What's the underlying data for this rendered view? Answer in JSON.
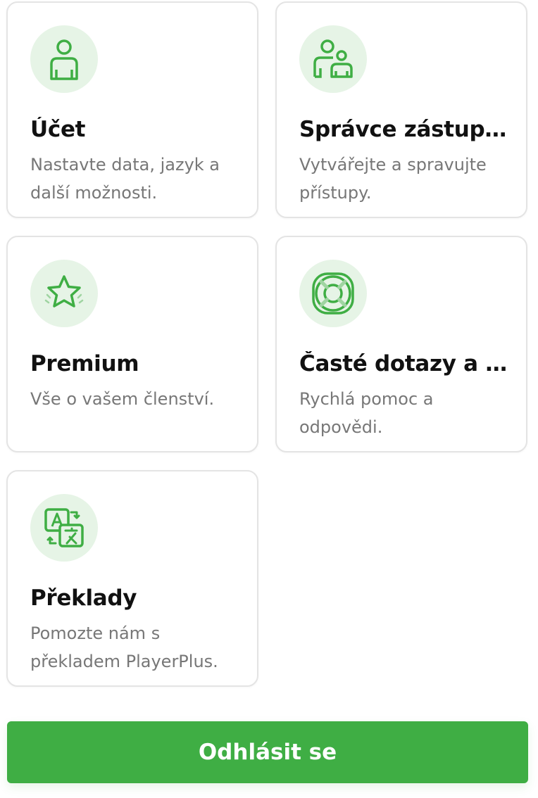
{
  "cards": [
    {
      "title": "Účet",
      "description": "Nastavte data, jazyk a další možnosti.",
      "icon": "user-icon"
    },
    {
      "title": "Správce zástupce",
      "description": "Vytvářejte a spravujte přístupy.",
      "icon": "users-icon"
    },
    {
      "title": "Premium",
      "description": "Vše o vašem členství.",
      "icon": "star-icon"
    },
    {
      "title": "Časté dotazy a po...",
      "description": "Rychlá pomoc a odpovědi.",
      "icon": "lifebuoy-icon"
    },
    {
      "title": "Překlady",
      "description": "Pomozte nám s překladem PlayerPlus.",
      "icon": "translate-icon"
    }
  ],
  "logout": {
    "label": "Odhlásit se"
  },
  "colors": {
    "accent": "#3fae44",
    "icon_background": "#e6f4e6",
    "card_border": "#e4e4e4",
    "title": "#111111",
    "description": "#777777"
  }
}
